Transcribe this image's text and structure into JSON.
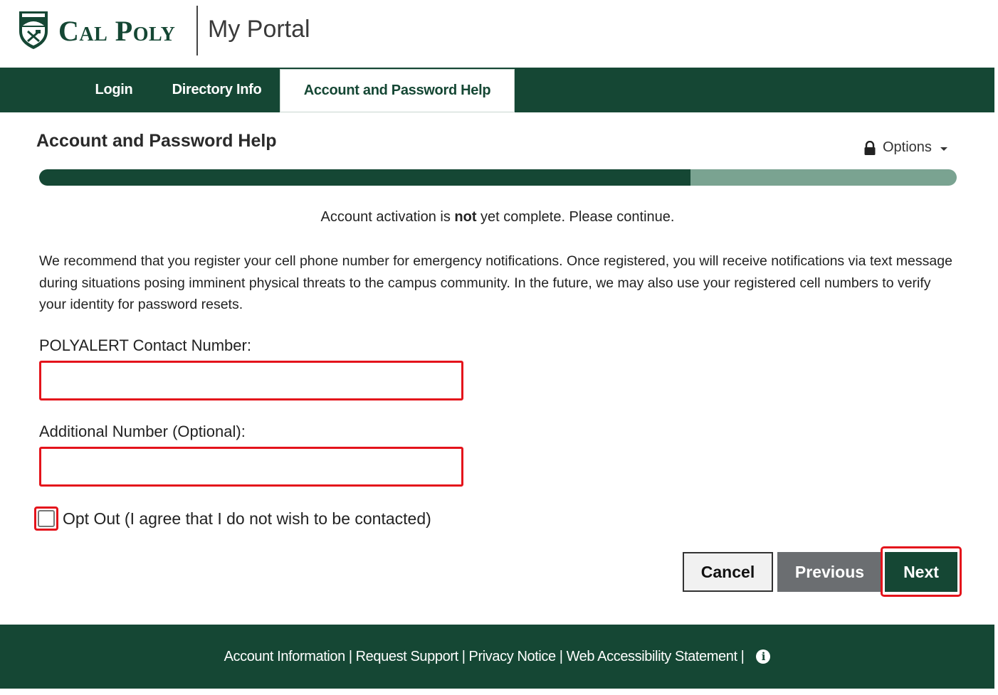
{
  "header": {
    "logo_text": "Cal Poly",
    "app_title": "My Portal"
  },
  "nav": {
    "items": [
      {
        "label": "Login",
        "active": false
      },
      {
        "label": "Directory Info",
        "active": false
      },
      {
        "label": "Account and Password Help",
        "active": true
      }
    ]
  },
  "page": {
    "title": "Account and Password Help",
    "options_label": "Options",
    "options_icon": "lock-icon",
    "progress_percent": 71
  },
  "status": {
    "prefix": "Account activation is ",
    "emphasis": "not",
    "suffix": " yet complete. Please continue."
  },
  "intro_text": "We recommend that you register your cell phone number for emergency notifications. Once registered, you will receive notifications via text message during situations posing imminent physical threats to the campus community. In the future, we may also use your registered cell numbers to verify your identity for password resets.",
  "form": {
    "primary_label": "POLYALERT Contact Number:",
    "primary_value": "",
    "additional_label": "Additional Number (Optional):",
    "additional_value": "",
    "optout_label": "Opt Out (I agree that I do not wish to be contacted)",
    "optout_checked": false
  },
  "buttons": {
    "cancel": "Cancel",
    "previous": "Previous",
    "next": "Next"
  },
  "footer": {
    "links": [
      "Account Information",
      "Request Support",
      "Privacy Notice",
      "Web Accessibility Statement"
    ],
    "separator": "|",
    "info_icon": "info-icon"
  },
  "colors": {
    "brand_green": "#154734",
    "progress_track": "#7aa391",
    "highlight_red": "#e4131b",
    "previous_gray": "#6b6e71"
  }
}
